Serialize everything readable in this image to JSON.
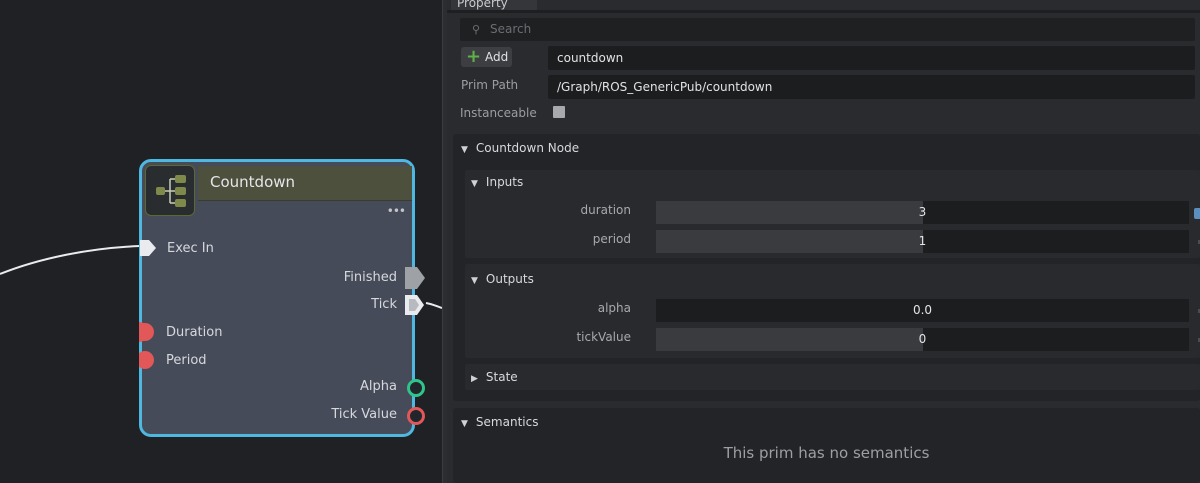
{
  "graph": {
    "node": {
      "title": "Countdown",
      "menu": "•••",
      "inputs": [
        {
          "label": "Exec In",
          "kind": "exec"
        },
        {
          "label": "Duration",
          "kind": "data"
        },
        {
          "label": "Period",
          "kind": "data"
        }
      ],
      "outputs": [
        {
          "label": "Finished",
          "kind": "exec"
        },
        {
          "label": "Tick",
          "kind": "exec"
        },
        {
          "label": "Alpha",
          "kind": "data"
        },
        {
          "label": "Tick Value",
          "kind": "data"
        }
      ]
    },
    "colors": {
      "node_border": "#4fb8e0",
      "node_body": "#464b5a",
      "header": "#4e503e",
      "pin_red": "#e25757",
      "pin_green": "#2fc48a",
      "wire": "#e9ebee"
    }
  },
  "panel": {
    "tab": "Property",
    "search_placeholder": "Search",
    "add_label": "Add",
    "prim_name": "countdown",
    "prim_path_label": "Prim Path",
    "prim_path": "/Graph/ROS_GenericPub/countdown",
    "instanceable_label": "Instanceable",
    "instanceable": false,
    "countdown_node": {
      "title": "Countdown Node",
      "inputs": {
        "title": "Inputs",
        "rows": [
          {
            "label": "duration",
            "value": "3"
          },
          {
            "label": "period",
            "value": "1"
          }
        ]
      },
      "outputs": {
        "title": "Outputs",
        "rows": [
          {
            "label": "alpha",
            "value": "0.0"
          },
          {
            "label": "tickValue",
            "value": "0"
          }
        ]
      },
      "state": {
        "title": "State"
      }
    },
    "semantics": {
      "title": "Semantics",
      "empty_message": "This prim has no semantics"
    }
  }
}
